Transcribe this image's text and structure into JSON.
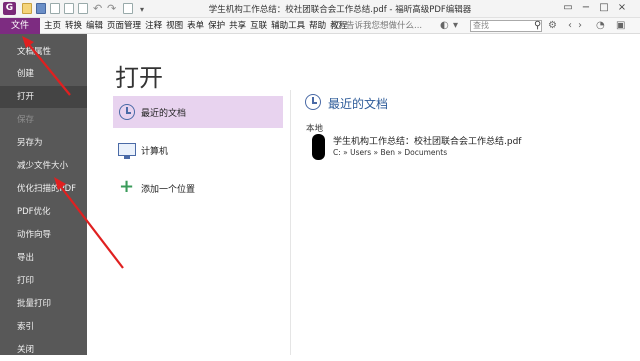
{
  "window": {
    "title": "学生机构工作总结：校社团联合会工作总结.pdf - 福昕高级PDF编辑器",
    "app_logo": "G",
    "controls": [
      "▭",
      "−",
      "□",
      "×"
    ]
  },
  "quick_access": {
    "dropdown": "▾"
  },
  "menubar": {
    "file_label": "文件",
    "items": [
      "主页",
      "转换",
      "编辑",
      "页面管理",
      "注释",
      "视图",
      "表单",
      "保护",
      "共享",
      "互联",
      "辅助工具",
      "帮助",
      "教程"
    ],
    "tell_me_placeholder": "告诉我您想做什么...",
    "search_placeholder": "查找"
  },
  "sidebar": {
    "items": [
      {
        "label": "文档属性",
        "state": "normal"
      },
      {
        "label": "创建",
        "state": "normal"
      },
      {
        "label": "打开",
        "state": "active"
      },
      {
        "label": "保存",
        "state": "disabled"
      },
      {
        "label": "另存为",
        "state": "normal"
      },
      {
        "label": "减少文件大小",
        "state": "normal"
      },
      {
        "label": "优化扫描的PDF",
        "state": "normal"
      },
      {
        "label": "PDF优化",
        "state": "normal"
      },
      {
        "label": "动作向导",
        "state": "normal"
      },
      {
        "label": "导出",
        "state": "normal"
      },
      {
        "label": "打印",
        "state": "normal"
      },
      {
        "label": "批量打印",
        "state": "normal"
      },
      {
        "label": "索引",
        "state": "normal"
      },
      {
        "label": "关闭",
        "state": "normal"
      }
    ]
  },
  "main": {
    "title": "打开",
    "places": [
      {
        "label": "最近的文档",
        "icon": "clock-icon",
        "active": true
      },
      {
        "label": "计算机",
        "icon": "computer-icon",
        "active": false
      },
      {
        "label": "添加一个位置",
        "icon": "plus-icon",
        "active": false
      }
    ],
    "recent": {
      "header": "最近的文档",
      "group_label": "本地",
      "files": [
        {
          "name": "学生机构工作总结：校社团联合会工作总结.pdf",
          "path": "C: » Users » Ben » Documents"
        }
      ]
    }
  },
  "colors": {
    "file_menu": "#7d2c81",
    "sidebar_bg": "#585858",
    "active_place_bg": "#e8d3ef",
    "accent_blue": "#2d5b99",
    "annotation_red": "#e02020"
  }
}
